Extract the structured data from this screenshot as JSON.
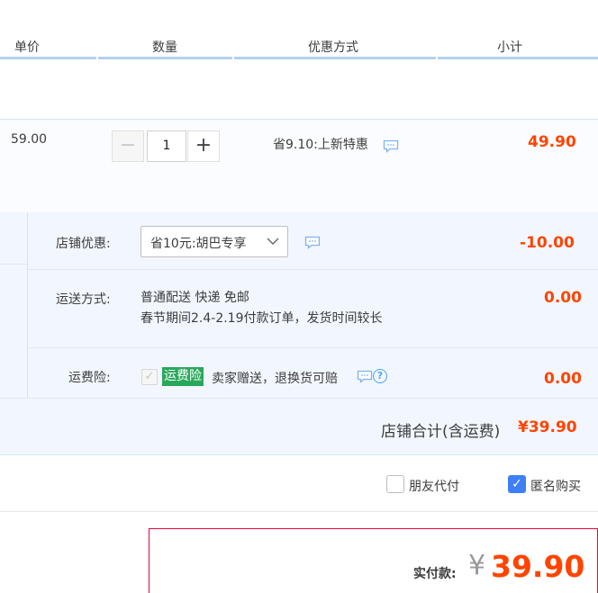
{
  "header": {
    "col_price": "单价",
    "col_qty": "数量",
    "col_promo": "优惠方式",
    "col_subtotal": "小计"
  },
  "item": {
    "unit_price": "59.00",
    "quantity": "1",
    "minus_label": "−",
    "plus_label": "+",
    "promo": "省9.10:上新特惠",
    "subtotal": "49.90"
  },
  "shop": {
    "discount_label": "店铺优惠:",
    "discount_selected": "省10元:胡巴专享",
    "discount_amount": "-10.00",
    "shipping_label": "运送方式:",
    "shipping_method": "普通配送 快递 免邮",
    "shipping_note": "春节期间2.4-2.19付款订单，发货时间较长",
    "shipping_amount": "0.00",
    "insurance_label": "运费险:",
    "insurance_badge": "运费险",
    "insurance_text": "卖家赠送，退换货可赔",
    "insurance_amount": "0.00",
    "total_label": "店铺合计(含运费)",
    "total_amount": "¥39.90"
  },
  "options": {
    "friend_pay_label": "朋友代付",
    "friend_pay_checked": false,
    "anonymous_label": "匿名购买",
    "anonymous_checked": true
  },
  "payment": {
    "label": "实付款:",
    "currency": "¥",
    "amount": "39.90"
  },
  "colors": {
    "price_red": "#ff4400",
    "accent_blue": "#3f7ff5",
    "badge_green": "#29a85c",
    "header_line": "#b2d1f0"
  }
}
